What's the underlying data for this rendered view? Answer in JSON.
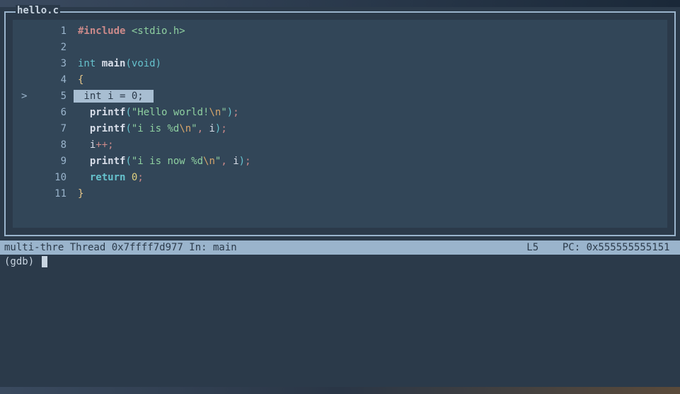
{
  "source_window": {
    "filename": "hello.c",
    "current_marker": ">",
    "lines": [
      {
        "num": "1"
      },
      {
        "num": "2"
      },
      {
        "num": "3"
      },
      {
        "num": "4"
      },
      {
        "num": "5"
      },
      {
        "num": "6"
      },
      {
        "num": "7"
      },
      {
        "num": "8"
      },
      {
        "num": "9"
      },
      {
        "num": "10"
      },
      {
        "num": "11"
      }
    ],
    "code": {
      "l1_include": "#include",
      "l1_header": "<stdio.h>",
      "l3_int": "int",
      "l3_main": "main",
      "l3_void": "void",
      "l4_brace": "{",
      "l5_highlight": " int i = 0; ",
      "l6_printf": "printf",
      "l6_str": "\"Hello world!",
      "l6_esc": "\\n",
      "l6_strend": "\"",
      "l7_printf": "printf",
      "l7_str": "\"i is %d",
      "l7_esc": "\\n",
      "l7_strend": "\"",
      "l7_arg": "i",
      "l8_var": "i",
      "l8_op": "++;",
      "l9_printf": "printf",
      "l9_str": "\"i is now %d",
      "l9_esc": "\\n",
      "l9_strend": "\"",
      "l9_arg": "i",
      "l10_return": "return",
      "l10_val": "0",
      "l11_brace": "}"
    }
  },
  "status_bar": {
    "left": "multi-thre Thread 0x7ffff7d977 In: main",
    "right": "L5    PC: 0x555555555151 "
  },
  "prompt": "(gdb) "
}
